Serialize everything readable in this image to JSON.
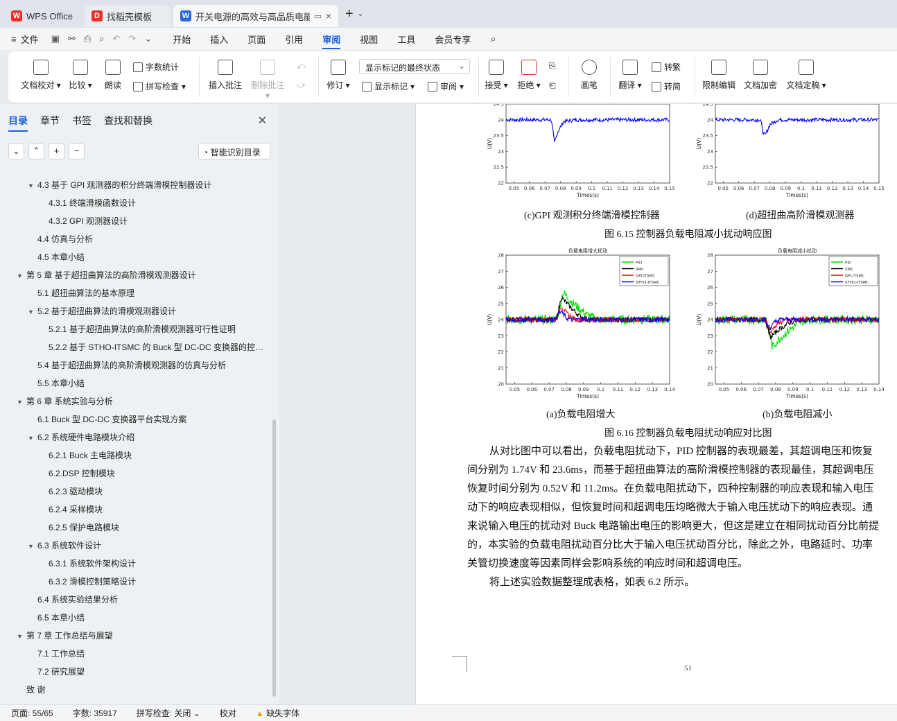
{
  "tabs": [
    {
      "label": "WPS Office"
    },
    {
      "label": "找稻壳模板"
    },
    {
      "label": "开关电源的高效与高品质电能"
    }
  ],
  "menubar": {
    "file": "文件",
    "items": [
      "开始",
      "插入",
      "页面",
      "引用",
      "审阅",
      "视图",
      "工具",
      "会员专享"
    ],
    "active": "审阅"
  },
  "ribbon": {
    "proof": "文档校对",
    "compare": "比较",
    "read": "朗读",
    "wordcount": "字数统计",
    "spell": "拼写检查",
    "insert_comment": "插入批注",
    "delete_comment": "删除批注",
    "revise": "修订",
    "display_state": "显示标记的最终状态",
    "show_marks": "显示标记",
    "review": "审阅",
    "accept": "接受",
    "reject": "拒绝",
    "pen": "画笔",
    "translate": "翻译",
    "to_traditional": "转繁",
    "to_simplified": "转简",
    "restrict": "限制编辑",
    "encrypt": "文档加密",
    "finalize": "文档定稿"
  },
  "nav": {
    "tabs": [
      "目录",
      "章节",
      "书签",
      "查找和替换"
    ],
    "smart_toc": "智能识别目录",
    "toc": [
      {
        "text": "4.3 基于 GPI 观测器的积分终端滑模控制器设计",
        "level": 2,
        "caret": true
      },
      {
        "text": "4.3.1 终端滑模函数设计",
        "level": 3,
        "caret": false
      },
      {
        "text": "4.3.2 GPI 观测器设计",
        "level": 3,
        "caret": false
      },
      {
        "text": "4.4 仿真与分析",
        "level": 2,
        "caret": false
      },
      {
        "text": "4.5 本章小结",
        "level": 2,
        "caret": false
      },
      {
        "text": "第 5 章 基于超扭曲算法的高阶滑模观测器设计",
        "level": 1,
        "caret": true
      },
      {
        "text": "5.1 超扭曲算法的基本原理",
        "level": 2,
        "caret": false
      },
      {
        "text": "5.2 基于超扭曲算法的滑模观测器设计",
        "level": 2,
        "caret": true
      },
      {
        "text": "5.2.1 基于超扭曲算法的高阶滑模观测器可行性证明",
        "level": 3,
        "caret": false
      },
      {
        "text": "5.2.2 基于 STHO-ITSMC 的 Buck 型 DC-DC 变换器的控…",
        "level": 3,
        "caret": false
      },
      {
        "text": "5.4 基于超扭曲算法的高阶滑模观测器的仿真与分析",
        "level": 2,
        "caret": false
      },
      {
        "text": "5.5 本章小结",
        "level": 2,
        "caret": false
      },
      {
        "text": "第 6 章 系统实验与分析",
        "level": 1,
        "caret": true
      },
      {
        "text": "6.1 Buck 型 DC-DC 变换器平台实现方案",
        "level": 2,
        "caret": false
      },
      {
        "text": "6.2 系统硬件电路模块介绍",
        "level": 2,
        "caret": true
      },
      {
        "text": "6.2.1 Buck 主电路模块",
        "level": 3,
        "caret": false
      },
      {
        "text": "6.2.DSP 控制模块",
        "level": 3,
        "caret": false
      },
      {
        "text": "6.2.3 驱动模块",
        "level": 3,
        "caret": false
      },
      {
        "text": "6.2.4 采样模块",
        "level": 3,
        "caret": false
      },
      {
        "text": "6.2.5 保护电路模块",
        "level": 3,
        "caret": false
      },
      {
        "text": "6.3 系统软件设计",
        "level": 2,
        "caret": true
      },
      {
        "text": "6.3.1 系统软件架构设计",
        "level": 3,
        "caret": false
      },
      {
        "text": "6.3.2 滑模控制策略设计",
        "level": 3,
        "caret": false
      },
      {
        "text": "6.4 系统实验结果分析",
        "level": 2,
        "caret": false
      },
      {
        "text": "6.5 本章小结",
        "level": 2,
        "caret": false
      },
      {
        "text": "第 7 章 工作总结与展望",
        "level": 1,
        "caret": true
      },
      {
        "text": "7.1 工作总结",
        "level": 2,
        "caret": false
      },
      {
        "text": "7.2 研究展望",
        "level": 2,
        "caret": false
      },
      {
        "text": "致 谢",
        "level": 1,
        "caret": false
      }
    ]
  },
  "document": {
    "cap_c": "(c)GPI 观测积分终端滑模控制器",
    "cap_d": "(d)超扭曲高阶滑模观测器",
    "fig615": "图 6.15 控制器负载电阻减小扰动响应图",
    "cap_a": "(a)负载电阻增大",
    "cap_b": "(b)负载电阻减小",
    "fig616": "图 6.16 控制器负载电阻扰动响应对比图",
    "para1": [
      "从对比图中可以看出，负载电阻扰动下，PID 控制器的表现最差，其超调电压和恢复",
      "间分别为 1.74V 和 23.6ms，而基于超扭曲算法的高阶滑模控制器的表现最佳，其超调电压",
      "恢复时间分别为 0.52V 和 11.2ms。在负载电阻扰动下，四种控制器的响应表现和输入电压",
      "动下的响应表现相似，但恢复时间和超调电压均略微大于输入电压扰动下的响应表现。通",
      "来说输入电压的扰动对 Buck 电路输出电压的影响更大，但这是建立在相同扰动百分比前提",
      "的，本实验的负载电阻扰动百分比大于输入电压扰动百分比，除此之外，电路延时、功率",
      "关管切换速度等因素同样会影响系统的响应时间和超调电压。"
    ],
    "para2": "将上述实验数据整理成表格，如表 6.2 所示。",
    "page_number": "51"
  },
  "chart_data": [
    {
      "type": "line",
      "title": "",
      "xlabel": "Times(s)",
      "ylabel": "U(V)",
      "xlim": [
        0.045,
        0.15
      ],
      "ylim": [
        22,
        24.5
      ],
      "xticks": [
        "0.05",
        "0.06",
        "0.07",
        "0.08",
        "0.09",
        "0.1",
        "0.11",
        "0.12",
        "0.13",
        "0.14",
        "0.15"
      ],
      "yticks": [
        "22",
        "22.5",
        "23",
        "23.5",
        "24",
        "24.5"
      ],
      "series": [
        {
          "color": "#0000ff",
          "x": [
            0.045,
            0.074,
            0.0755,
            0.076,
            0.078,
            0.082,
            0.09,
            0.15
          ],
          "y": [
            24.0,
            24.0,
            23.5,
            23.25,
            23.6,
            23.95,
            24.0,
            24.0
          ]
        }
      ]
    },
    {
      "type": "line",
      "title": "",
      "xlabel": "Times(s)",
      "ylabel": "U(V)",
      "xlim": [
        0.045,
        0.15
      ],
      "ylim": [
        22,
        24.5
      ],
      "xticks": [
        "0.05",
        "0.06",
        "0.07",
        "0.08",
        "0.09",
        "0.1",
        "0.11",
        "0.12",
        "0.13",
        "0.14",
        "0.15"
      ],
      "yticks": [
        "22",
        "22.5",
        "23",
        "23.5",
        "24",
        "24.5"
      ],
      "series": [
        {
          "color": "#0000ff",
          "x": [
            0.045,
            0.074,
            0.0755,
            0.077,
            0.08,
            0.085,
            0.15
          ],
          "y": [
            24.0,
            24.0,
            23.6,
            23.5,
            23.85,
            24.0,
            24.0
          ]
        }
      ]
    },
    {
      "type": "line",
      "title": "负载电阻增大扰动",
      "xlabel": "Times(s)",
      "ylabel": "U(V)",
      "xlim": [
        0.045,
        0.14
      ],
      "ylim": [
        20,
        28
      ],
      "xticks": [
        "0.05",
        "0.06",
        "0.07",
        "0.08",
        "0.09",
        "0.1",
        "0.11",
        "0.12",
        "0.13",
        "0.14"
      ],
      "yticks": [
        "20",
        "21",
        "22",
        "23",
        "24",
        "25",
        "26",
        "27",
        "28"
      ],
      "legend": [
        "PID",
        "SMC",
        "GPI-ITSMC",
        "STHO-ITSMC"
      ],
      "series": [
        {
          "name": "PID",
          "color": "#00dd00",
          "x": [
            0.045,
            0.074,
            0.076,
            0.078,
            0.084,
            0.092,
            0.098,
            0.14
          ],
          "y": [
            24.0,
            24.0,
            24.6,
            25.7,
            25.0,
            24.3,
            24.0,
            24.0
          ]
        },
        {
          "name": "SMC",
          "color": "#000000",
          "x": [
            0.045,
            0.074,
            0.076,
            0.077,
            0.082,
            0.088,
            0.094,
            0.14
          ],
          "y": [
            24.0,
            24.0,
            24.8,
            25.4,
            24.8,
            24.2,
            24.0,
            24.0
          ]
        },
        {
          "name": "GPI-ITSMC",
          "color": "#ff0000",
          "x": [
            0.045,
            0.074,
            0.076,
            0.077,
            0.08,
            0.085,
            0.14
          ],
          "y": [
            24.0,
            24.0,
            24.5,
            24.9,
            24.4,
            24.0,
            24.0
          ]
        },
        {
          "name": "STHO-ITSMC",
          "color": "#0000ff",
          "x": [
            0.045,
            0.074,
            0.075,
            0.077,
            0.08,
            0.083,
            0.14
          ],
          "y": [
            24.0,
            24.0,
            24.3,
            24.5,
            24.1,
            24.0,
            24.0
          ]
        }
      ]
    },
    {
      "type": "line",
      "title": "负载电阻减小扰动",
      "xlabel": "Times(s)",
      "ylabel": "U(V)",
      "xlim": [
        0.045,
        0.14
      ],
      "ylim": [
        20,
        28
      ],
      "xticks": [
        "0.05",
        "0.06",
        "0.07",
        "0.08",
        "0.09",
        "0.1",
        "0.11",
        "0.12",
        "0.13",
        "0.14"
      ],
      "yticks": [
        "20",
        "21",
        "22",
        "23",
        "24",
        "25",
        "26",
        "27",
        "28"
      ],
      "legend": [
        "PID",
        "SMC",
        "GPI-ITSMC",
        "STHO-ITSMC"
      ],
      "series": [
        {
          "name": "PID",
          "color": "#00dd00",
          "x": [
            0.045,
            0.074,
            0.076,
            0.078,
            0.084,
            0.092,
            0.098,
            0.14
          ],
          "y": [
            24.0,
            24.0,
            23.4,
            22.3,
            23.0,
            23.7,
            24.0,
            24.0
          ]
        },
        {
          "name": "SMC",
          "color": "#000000",
          "x": [
            0.045,
            0.074,
            0.076,
            0.077,
            0.082,
            0.088,
            0.094,
            0.14
          ],
          "y": [
            24.0,
            24.0,
            23.2,
            22.9,
            23.4,
            23.8,
            24.0,
            24.0
          ]
        },
        {
          "name": "GPI-ITSMC",
          "color": "#ff0000",
          "x": [
            0.045,
            0.074,
            0.076,
            0.077,
            0.08,
            0.085,
            0.14
          ],
          "y": [
            24.0,
            24.0,
            23.5,
            23.2,
            23.6,
            24.0,
            24.0
          ]
        },
        {
          "name": "STHO-ITSMC",
          "color": "#0000ff",
          "x": [
            0.045,
            0.074,
            0.075,
            0.077,
            0.08,
            0.083,
            0.14
          ],
          "y": [
            24.0,
            24.0,
            23.7,
            23.5,
            23.9,
            24.0,
            24.0
          ]
        }
      ]
    }
  ],
  "status": {
    "page": "页面: 55/65",
    "words": "字数: 35917",
    "spell": "拼写检查: 关闭",
    "proof": "校对",
    "missing_font": "缺失字体"
  },
  "colors": {
    "accent": "#1a5fd6",
    "wps_red": "#e8312f",
    "doc_blue": "#2b66d9"
  }
}
